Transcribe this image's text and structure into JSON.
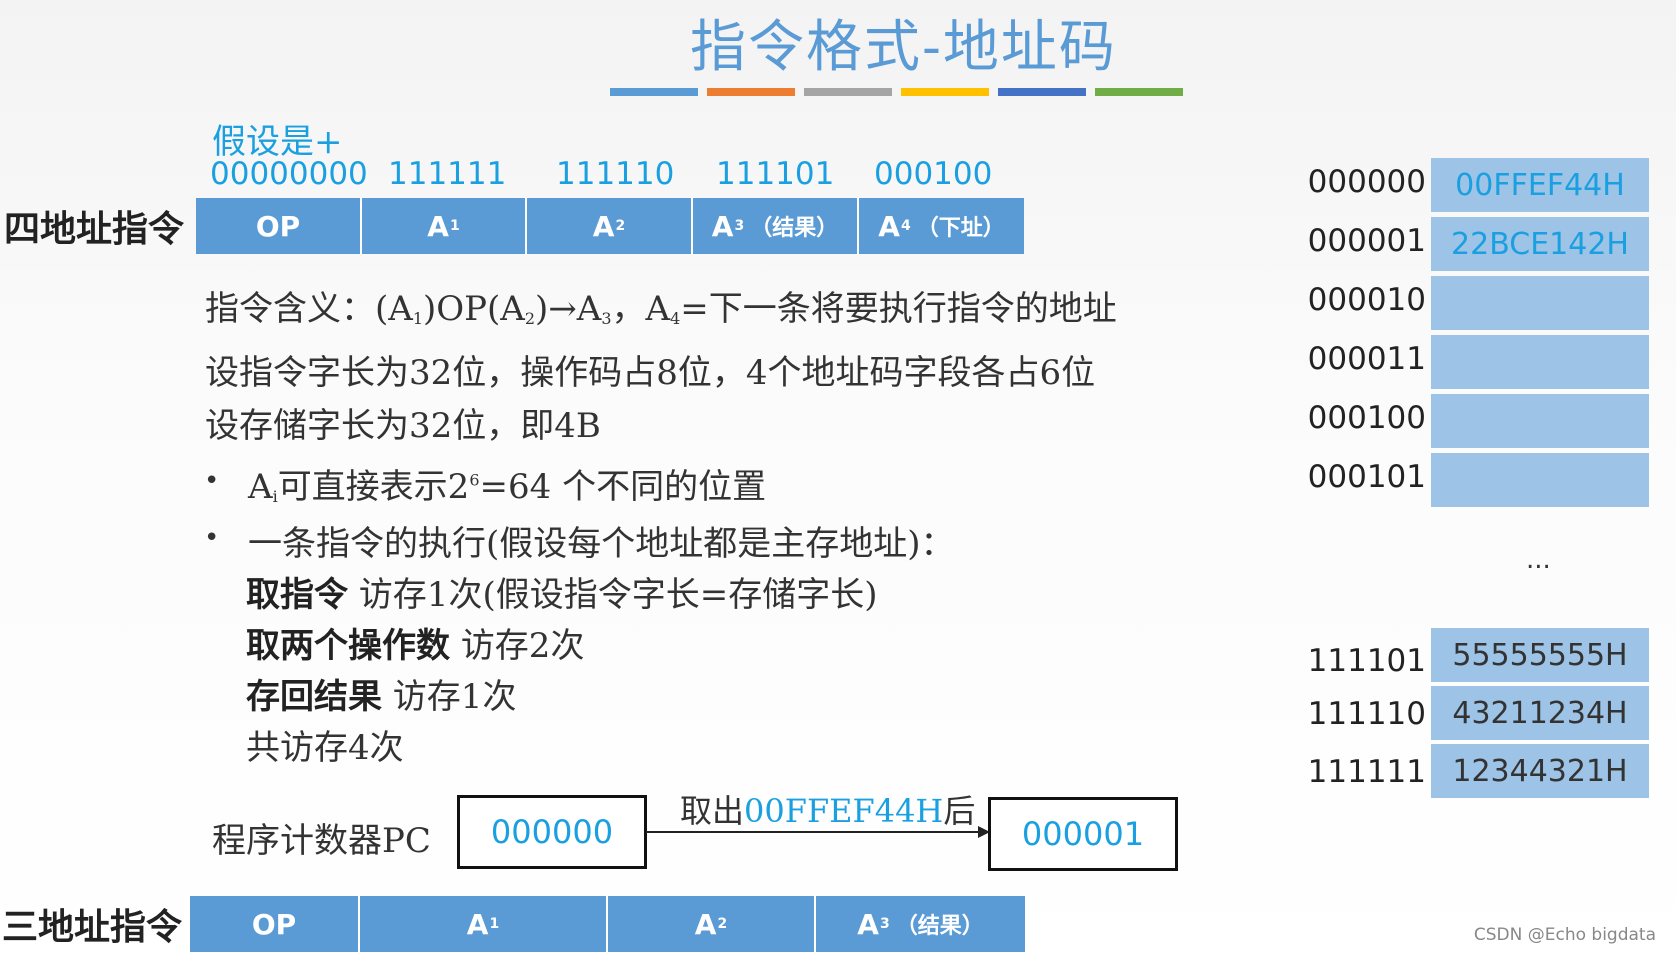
{
  "title": "指令格式-地址码",
  "accent_bars": [
    "#5b9bd5",
    "#ed7d31",
    "#a5a5a5",
    "#ffc000",
    "#4472c4",
    "#70ad47"
  ],
  "assumption_label": "假设是+",
  "four_addr": {
    "label": "四地址指令",
    "binary_values": [
      "00000000",
      "111111",
      "111110",
      "111101",
      "000100"
    ],
    "fields": [
      {
        "main": "OP",
        "sub": "",
        "note": ""
      },
      {
        "main": "A",
        "sub": "1",
        "note": ""
      },
      {
        "main": "A",
        "sub": "2",
        "note": ""
      },
      {
        "main": "A",
        "sub": "3",
        "note": "（结果）"
      },
      {
        "main": "A",
        "sub": "4",
        "note": "（下址）"
      }
    ]
  },
  "meaning": {
    "prefix": "指令含义：(A",
    "s1": "1",
    "mid1": ")OP(A",
    "s2": "2",
    "mid2": ")→A",
    "s3": "3",
    "mid3": "，A",
    "s4": "4",
    "suffix": "=下一条将要执行指令的地址"
  },
  "line2": "设指令字长为32位，操作码占8位，4个地址码字段各占6位",
  "line3": "设存储字长为32位，即4B",
  "bullet1": {
    "a": "A",
    "sub": "i",
    "mid": "可直接表示2",
    "sup": "6",
    "rest": "=64 个不同的位置"
  },
  "bullet2": "一条指令的执行(假设每个地址都是主存地址)：",
  "steps": [
    {
      "bold": "取指令",
      "text": " 访存1次(假设指令字长=存储字长)"
    },
    {
      "bold": "取两个操作数",
      "text": " 访存2次"
    },
    {
      "bold": "存回结果",
      "text": " 访存1次"
    },
    {
      "bold": "",
      "text": "共访存4次"
    }
  ],
  "pc": {
    "label": "程序计数器PC",
    "before": "000000",
    "after": "000001",
    "arrow_label_prefix": "取出",
    "arrow_label_value": "00FFEF44H",
    "arrow_label_suffix": "后"
  },
  "three_addr": {
    "label": "三地址指令",
    "fields": [
      {
        "main": "OP",
        "sub": "",
        "note": ""
      },
      {
        "main": "A",
        "sub": "1",
        "note": ""
      },
      {
        "main": "A",
        "sub": "2",
        "note": ""
      },
      {
        "main": "A",
        "sub": "3",
        "note": "（结果）"
      }
    ]
  },
  "memory": {
    "top": [
      {
        "addr": "000000",
        "value": "00FFEF44H"
      },
      {
        "addr": "000001",
        "value": "22BCE142H"
      },
      {
        "addr": "000010",
        "value": ""
      },
      {
        "addr": "000011",
        "value": ""
      },
      {
        "addr": "000100",
        "value": ""
      },
      {
        "addr": "000101",
        "value": ""
      }
    ],
    "ellipsis": "...",
    "bottom": [
      {
        "addr": "111101",
        "value": "55555555H"
      },
      {
        "addr": "111110",
        "value": "43211234H"
      },
      {
        "addr": "111111",
        "value": "12344321H"
      }
    ],
    "highlight_color": "#1aa0e0"
  },
  "watermark": "CSDN @Echo bigdata"
}
